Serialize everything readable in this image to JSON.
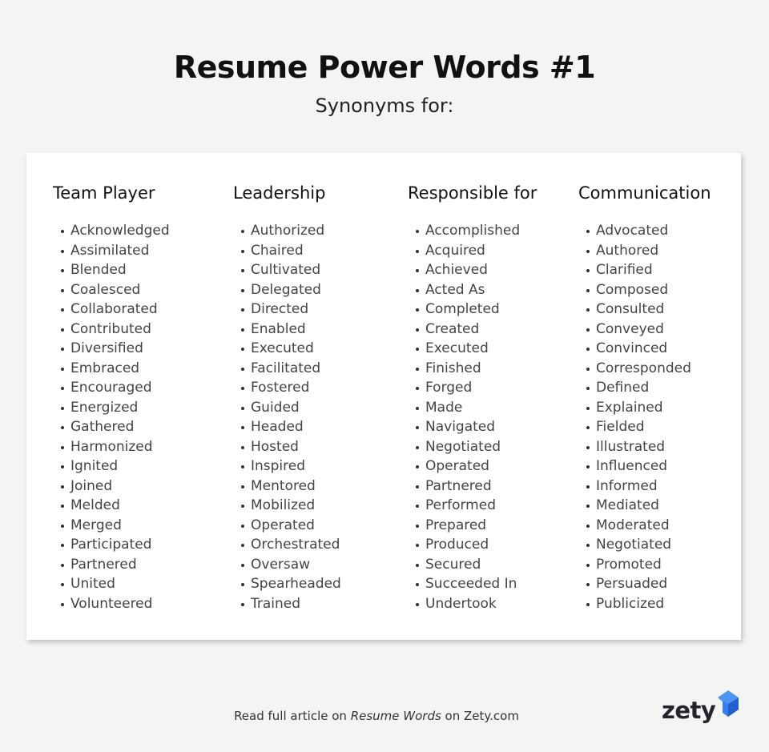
{
  "header": {
    "title": "Resume Power Words #1",
    "subtitle": "Synonyms for:"
  },
  "columns": [
    {
      "heading": "Team Player",
      "items": [
        "Acknowledged",
        "Assimilated",
        "Blended",
        "Coalesced",
        "Collaborated",
        "Contributed",
        "Diversified",
        "Embraced",
        "Encouraged",
        "Energized",
        "Gathered",
        "Harmonized",
        "Ignited",
        "Joined",
        "Melded",
        "Merged",
        "Participated",
        "Partnered",
        "United",
        "Volunteered"
      ]
    },
    {
      "heading": "Leadership",
      "items": [
        "Authorized",
        "Chaired",
        "Cultivated",
        "Delegated",
        "Directed",
        "Enabled",
        "Executed",
        "Facilitated",
        "Fostered",
        "Guided",
        "Headed",
        "Hosted",
        "Inspired",
        "Mentored",
        "Mobilized",
        "Operated",
        "Orchestrated",
        "Oversaw",
        "Spearheaded",
        "Trained"
      ]
    },
    {
      "heading": "Responsible for",
      "items": [
        "Accomplished",
        "Acquired",
        "Achieved",
        "Acted As",
        "Completed",
        "Created",
        "Executed",
        "Finished",
        "Forged",
        "Made",
        "Navigated",
        "Negotiated",
        "Operated",
        "Partnered",
        "Performed",
        "Prepared",
        "Produced",
        "Secured",
        "Succeeded In",
        "Undertook"
      ]
    },
    {
      "heading": "Communication",
      "items": [
        "Advocated",
        "Authored",
        "Clarified",
        "Composed",
        "Consulted",
        "Conveyed",
        "Convinced",
        "Corresponded",
        "Defined",
        "Explained",
        "Fielded",
        "Illustrated",
        "Influenced",
        "Informed",
        "Mediated",
        "Moderated",
        "Negotiated",
        "Promoted",
        "Persuaded",
        "Publicized"
      ]
    }
  ],
  "footer": {
    "prefix": "Read full article on ",
    "link_text": "Resume Words",
    "suffix": " on Zety.com"
  },
  "logo": {
    "text": "zety",
    "icon": "zety-logo-mark-icon",
    "colors": {
      "text": "#22252b",
      "mark_light": "#3b8ef0",
      "mark_dark": "#1f5fd0"
    }
  }
}
